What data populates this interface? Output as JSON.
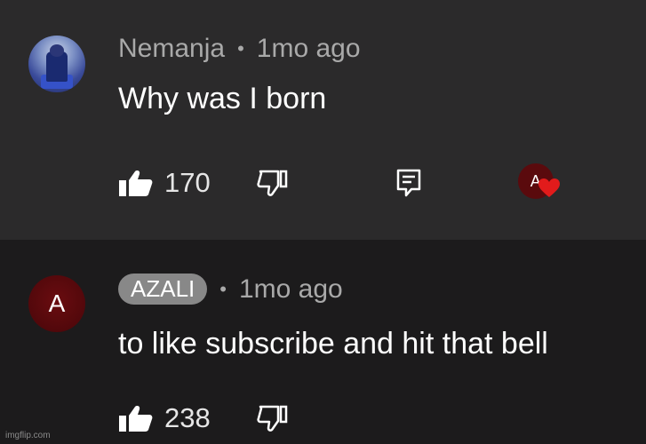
{
  "comments": [
    {
      "author": "Nemanja",
      "time": "1mo ago",
      "text": "Why was I born",
      "likes": "170",
      "creator_avatar_letter": "A"
    },
    {
      "author": "AZALI",
      "avatar_letter": "A",
      "time": "1mo ago",
      "text": "to like subscribe and hit that bell",
      "likes": "238"
    }
  ],
  "meta_separator": "•",
  "watermark": "imgflip.com",
  "colors": {
    "heart": "#e21b1b",
    "avatar_red": "#5a0a0d",
    "creator_chip": "#888888"
  }
}
